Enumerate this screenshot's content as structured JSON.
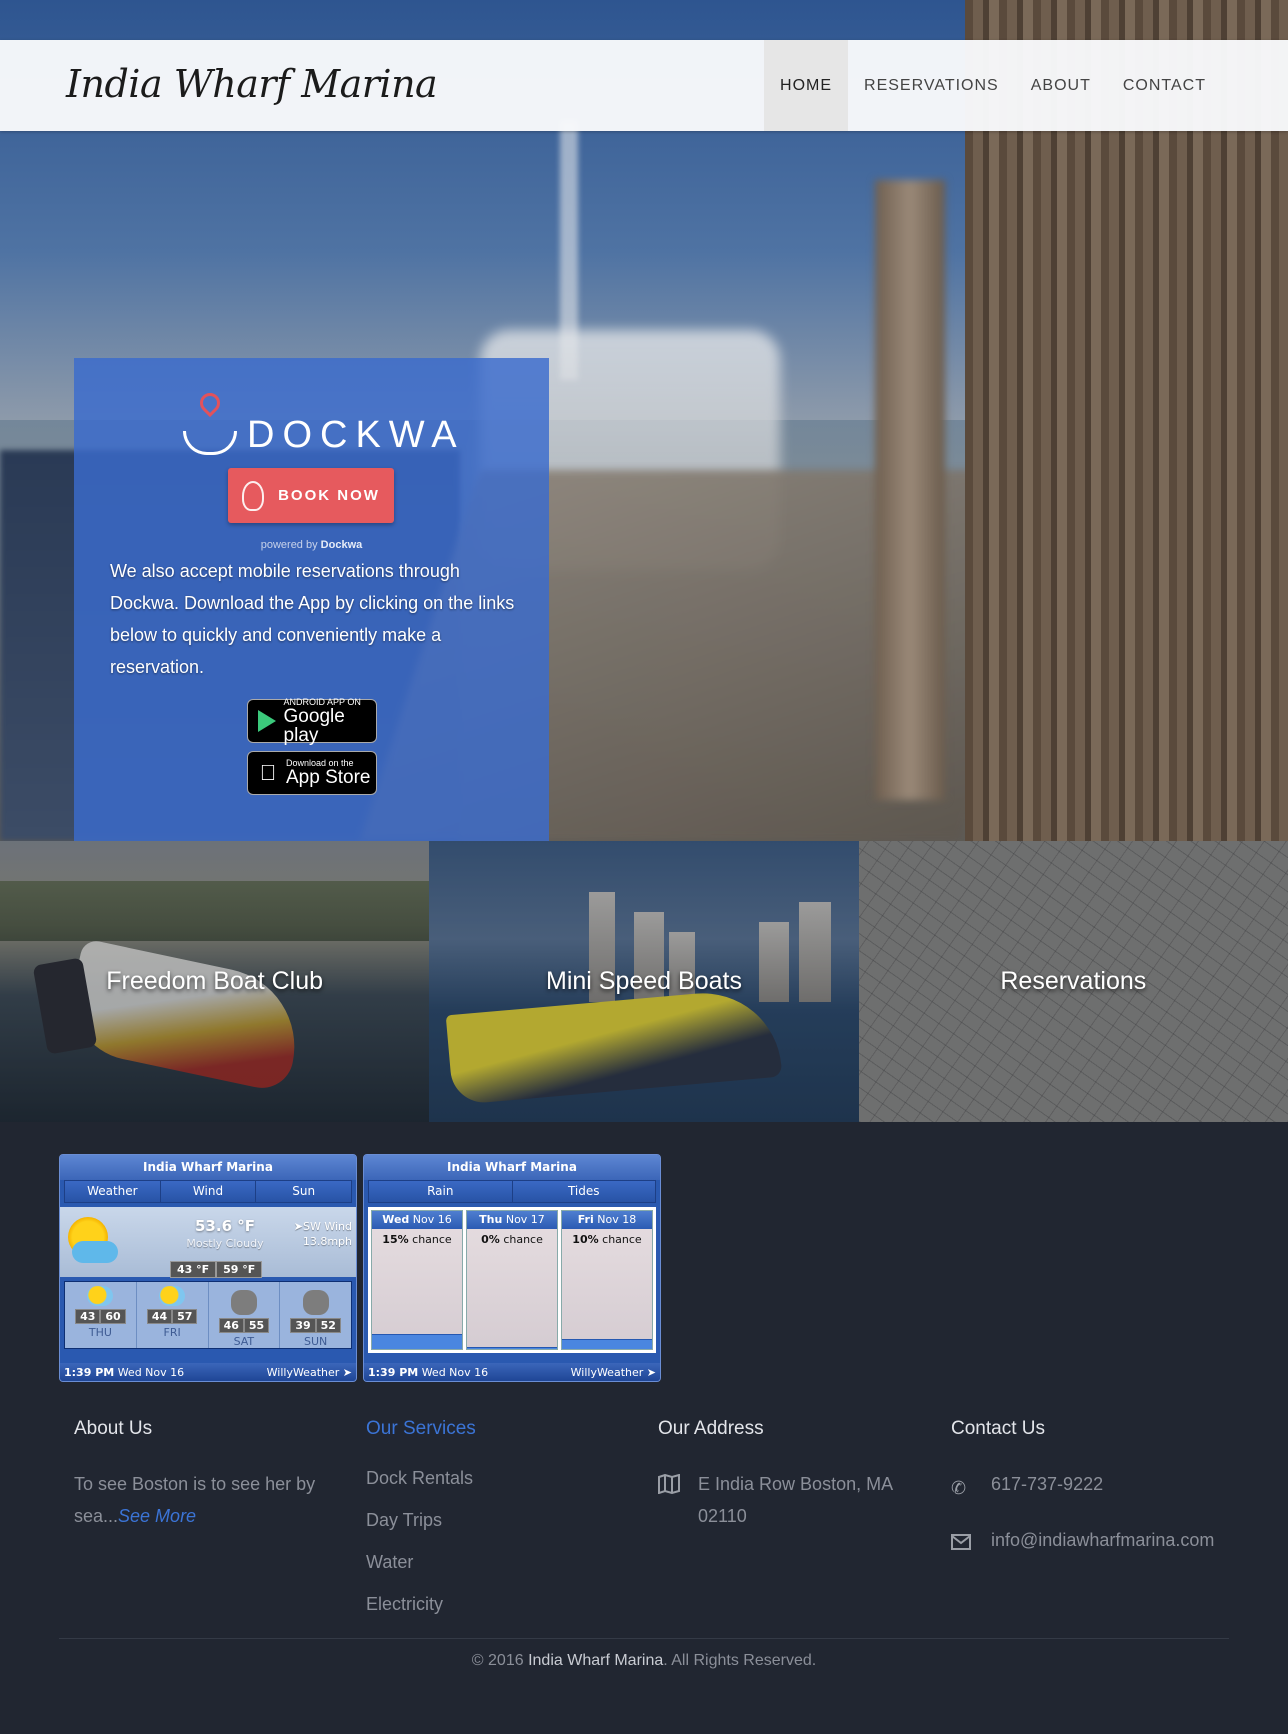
{
  "nav": {
    "logo": "India Wharf Marina",
    "items": [
      {
        "label": "HOME",
        "active": true
      },
      {
        "label": "RESERVATIONS",
        "active": false
      },
      {
        "label": "ABOUT",
        "active": false
      },
      {
        "label": "CONTACT",
        "active": false
      }
    ]
  },
  "dockwa": {
    "brand": "DOCKWA",
    "book_label": "BOOK NOW",
    "powered_prefix": "powered by",
    "powered_brand": "Dockwa",
    "description": "We also accept mobile reservations through Dockwa. Download the App by clicking on the links below to quickly and conveniently make a reservation.",
    "google_play": {
      "small": "ANDROID APP ON",
      "big": "Google play"
    },
    "app_store": {
      "small": "Download on the",
      "big": "App Store"
    }
  },
  "tiles": [
    {
      "label": "Freedom Boat Club"
    },
    {
      "label": "Mini Speed Boats"
    },
    {
      "label": "Reservations"
    }
  ],
  "weather": {
    "title": "India Wharf Marina",
    "tabs": [
      "Weather",
      "Wind",
      "Sun"
    ],
    "current": {
      "temp": "53.6 °F",
      "condition": "Mostly Cloudy",
      "wind_dir": "SW Wind",
      "wind_speed": "13.8mph",
      "min": "43 °F",
      "max": "59 °F"
    },
    "days": [
      {
        "name": "THU",
        "low": "43",
        "high": "60",
        "icon": "sun-cloud-icon"
      },
      {
        "name": "FRI",
        "low": "44",
        "high": "57",
        "icon": "sun-cloud-icon"
      },
      {
        "name": "SAT",
        "low": "46",
        "high": "55",
        "icon": "rain-cloud-icon"
      },
      {
        "name": "SUN",
        "low": "39",
        "high": "52",
        "icon": "rain-cloud-icon"
      }
    ],
    "footer_time": "1:39 PM",
    "footer_date": "Wed Nov 16",
    "footer_brand": "WillyWeather"
  },
  "rain": {
    "title": "India Wharf Marina",
    "tabs": [
      "Rain",
      "Tides"
    ],
    "days": [
      {
        "day": "Wed",
        "date": "Nov 16",
        "pct": "15%",
        "chance": "chance",
        "fraction": 0.15
      },
      {
        "day": "Thu",
        "date": "Nov 17",
        "pct": "0%",
        "chance": "chance",
        "fraction": 0.0
      },
      {
        "day": "Fri",
        "date": "Nov 18",
        "pct": "10%",
        "chance": "chance",
        "fraction": 0.1
      }
    ],
    "footer_time": "1:39 PM",
    "footer_date": "Wed Nov 16",
    "footer_brand": "WillyWeather"
  },
  "footer": {
    "about": {
      "heading": "About Us",
      "text": "To see Boston is to see her by sea...",
      "more": "See More"
    },
    "services": {
      "heading": "Our Services",
      "items": [
        "Dock Rentals",
        "Day Trips",
        "Water",
        "Electricity"
      ]
    },
    "address": {
      "heading": "Our Address",
      "text": "E India Row Boston, MA 02110"
    },
    "contact": {
      "heading": "Contact Us",
      "phone": "617-737-9222",
      "email": "info@indiawharfmarina.com"
    },
    "copyright_prefix": "© 2016",
    "copyright_brand": "India Wharf Marina",
    "copyright_suffix": ". All Rights Reserved."
  },
  "colors": {
    "accent": "#3b74d6",
    "book_button": "#e65a5e",
    "footer_bg": "#212631"
  }
}
